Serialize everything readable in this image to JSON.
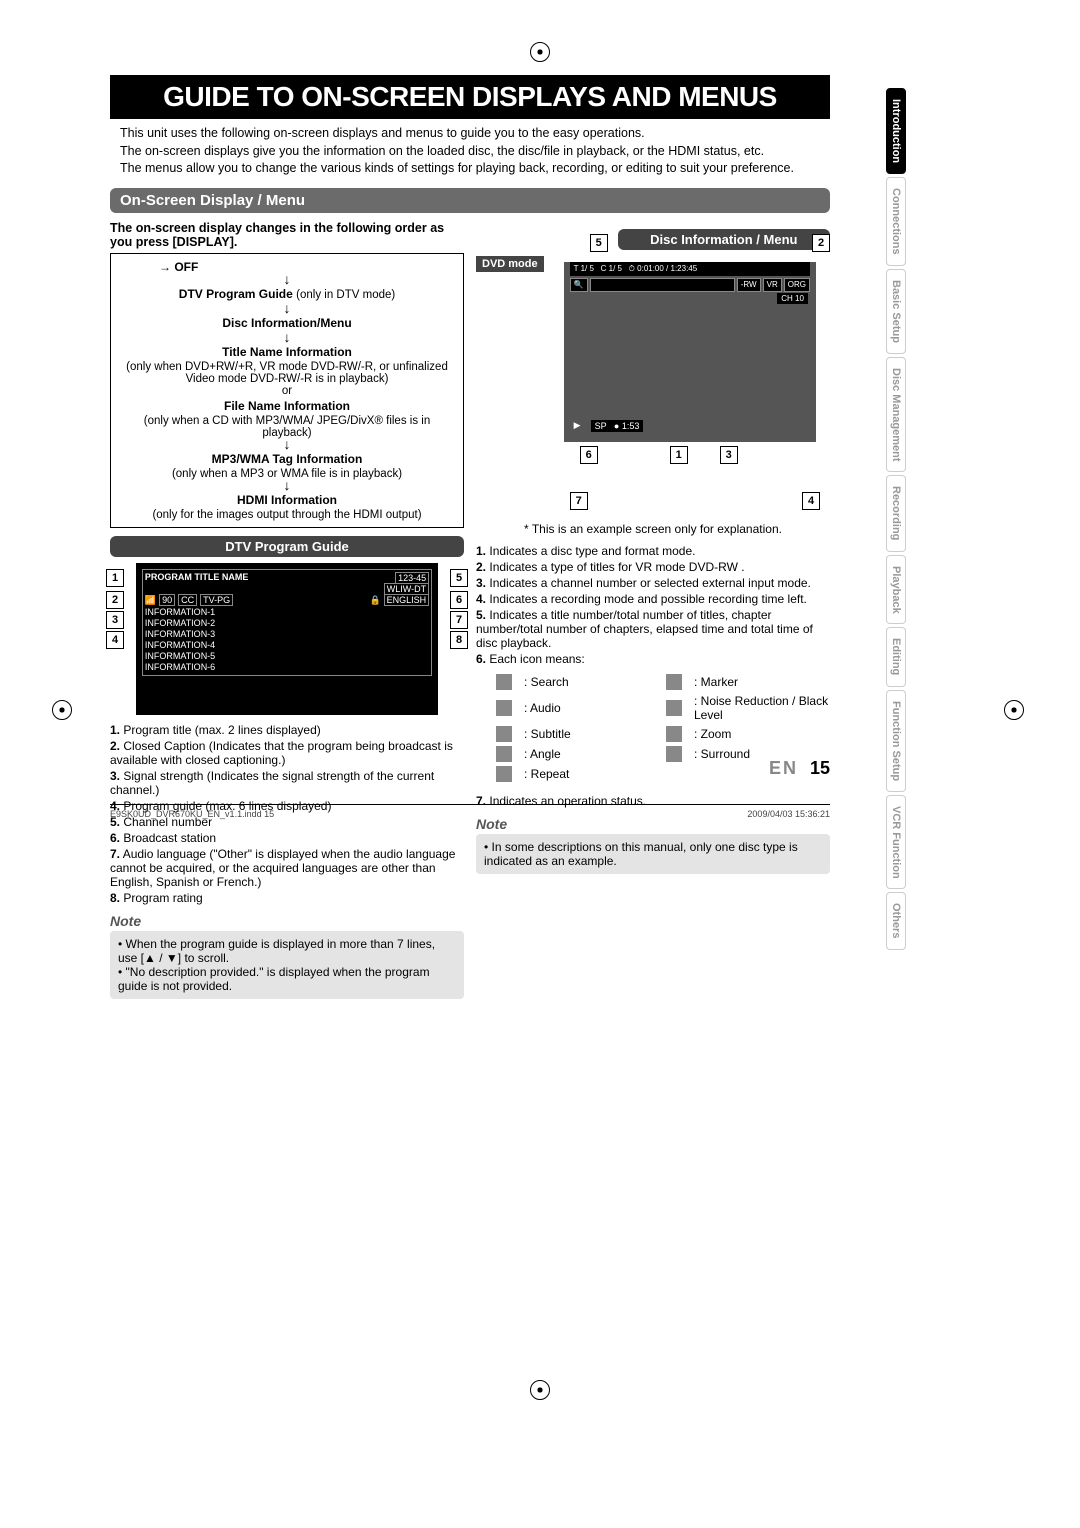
{
  "title": "GUIDE TO ON-SCREEN DISPLAYS AND MENUS",
  "intro": [
    "This unit uses the following on-screen displays and menus to guide you to the easy operations.",
    "The on-screen displays give you the information on the loaded disc, the disc/file in playback, or the HDMI status, etc.",
    "The menus allow you to change the various kinds of settings for playing back, recording, or editing to suit your preference."
  ],
  "section_header": "On-Screen Display / Menu",
  "left": {
    "lead": "The on-screen display changes in the following order as you press [DISPLAY].",
    "flow": {
      "off": "OFF",
      "dtv_guide": "DTV Program Guide",
      "dtv_guide_note": "(only in DTV mode)",
      "disc_info": "Disc Information/Menu",
      "title_name": "Title Name Information",
      "title_name_note": "(only when DVD+RW/+R, VR mode DVD-RW/-R, or unfinalized Video mode DVD-RW/-R is in playback)",
      "or": "or",
      "file_name": "File Name Information",
      "file_name_note": "(only when a CD with MP3/WMA/ JPEG/DivX® files is in playback)",
      "mp3": "MP3/WMA Tag Information",
      "mp3_note": "(only when a MP3 or WMA file is in playback)",
      "hdmi": "HDMI Information",
      "hdmi_note": "(only for the images output through the HDMI output)"
    },
    "dtv_header": "DTV Program Guide",
    "dtv_preview": {
      "program_title": "PROGRAM TITLE NAME",
      "channel_num": "123-45",
      "station": "WLIW-DT",
      "signal": "90",
      "cc": "CC",
      "rating": "TV-PG",
      "lang_icon": "🔒",
      "lang": "ENGLISH",
      "info_lines": [
        "INFORMATION-1",
        "INFORMATION-2",
        "INFORMATION-3",
        "INFORMATION-4",
        "INFORMATION-5",
        "INFORMATION-6"
      ]
    },
    "dtv_list": [
      "Program title (max. 2 lines displayed)",
      "Closed Caption (Indicates that the program being broadcast is available with closed captioning.)",
      "Signal strength (Indicates the signal strength of the current channel.)",
      "Program guide (max. 6 lines displayed)",
      "Channel number",
      "Broadcast station",
      "Audio language (\"Other\" is displayed when the audio language cannot be acquired, or the acquired languages are other than English, Spanish or French.)",
      "Program rating"
    ],
    "note_head": "Note",
    "note": [
      "When the program guide is displayed in more than 7 lines, use [▲ / ▼] to scroll.",
      "\"No description provided.\" is displayed when the program guide is not provided."
    ]
  },
  "right": {
    "disc_header": "Disc Information / Menu",
    "dvd_mode": "DVD mode",
    "dvd_preview": {
      "t_count": "1/   5",
      "c_label": "C",
      "c_count": "1/   5",
      "clock_icon": "⏱",
      "time": "0:01:00 / 1:23:45",
      "search_icon": "🔍",
      "rw": "-RW",
      "vr": "VR",
      "org": "ORG",
      "ch": "CH   10",
      "play": "▶",
      "sp": "SP",
      "rec_icon": "●",
      "rec_time": "1:53"
    },
    "example_note": "This is an example screen only for explanation.",
    "disc_list": [
      "Indicates a disc type and format mode.",
      "Indicates a type of titles for VR mode DVD-RW .",
      "Indicates a channel number or selected external input mode.",
      "Indicates a recording mode and possible recording time left.",
      "Indicates a title number/total number of titles, chapter number/total number of chapters, elapsed time and total time of disc playback.",
      "Each icon means:"
    ],
    "icons": {
      "c1": ": Search",
      "c1b": ": Marker",
      "c2": ": Audio",
      "c2b": ": Noise Reduction / Black Level",
      "c3": ": Subtitle",
      "c3b": ": Zoom",
      "c4": ": Angle",
      "c4b": ": Surround",
      "c5": ": Repeat"
    },
    "item7": "Indicates an operation status.",
    "note_head": "Note",
    "note": "In some descriptions on this manual, only one disc type is indicated as an example."
  },
  "tabs": [
    "Introduction",
    "Connections",
    "Basic Setup",
    "Disc Management",
    "Recording",
    "Playback",
    "Editing",
    "Function Setup",
    "VCR Function",
    "Others"
  ],
  "active_tab_index": 0,
  "page_lang": "EN",
  "page_num": "15",
  "footer_left": "E9SK0UD_DVR670KU_EN_v1.1.indd   15",
  "footer_right": "2009/04/03   15:36:21"
}
